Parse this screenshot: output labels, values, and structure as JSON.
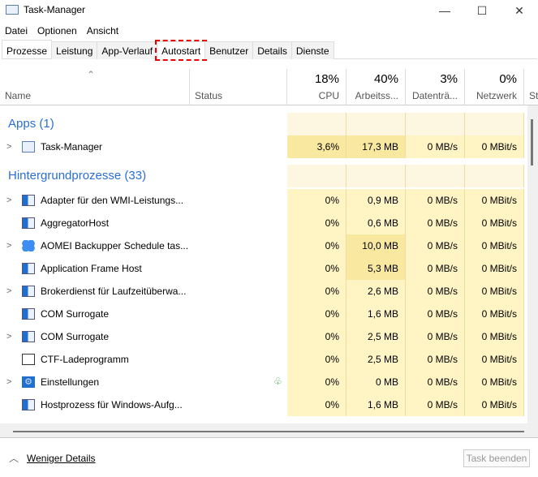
{
  "window": {
    "title": "Task-Manager",
    "minimize": "—",
    "maximize": "☐",
    "close": "✕"
  },
  "menu": [
    "Datei",
    "Optionen",
    "Ansicht"
  ],
  "tabs": [
    "Prozesse",
    "Leistung",
    "App-Verlauf",
    "Autostart",
    "Benutzer",
    "Details",
    "Dienste"
  ],
  "columns": {
    "name": "Name",
    "status": "Status",
    "cpu_pct": "18%",
    "cpu": "CPU",
    "mem_pct": "40%",
    "mem": "Arbeitss...",
    "disk_pct": "3%",
    "disk": "Datenträ...",
    "net_pct": "0%",
    "net": "Netzwerk",
    "extra": "St"
  },
  "groups": {
    "apps": "Apps (1)",
    "background": "Hintergrundprozesse (33)"
  },
  "apps": [
    {
      "name": "Task-Manager",
      "cpu": "3,6%",
      "mem": "17,3 MB",
      "disk": "0 MB/s",
      "net": "0 MBit/s"
    }
  ],
  "processes": [
    {
      "name": "Adapter für den WMI-Leistungs...",
      "cpu": "0%",
      "mem": "0,9 MB",
      "disk": "0 MB/s",
      "net": "0 MBit/s",
      "expand": true,
      "icon": "window-icon"
    },
    {
      "name": "AggregatorHost",
      "cpu": "0%",
      "mem": "0,6 MB",
      "disk": "0 MB/s",
      "net": "0 MBit/s",
      "expand": false,
      "icon": "window-icon"
    },
    {
      "name": "AOMEI Backupper Schedule tas...",
      "cpu": "0%",
      "mem": "10,0 MB",
      "disk": "0 MB/s",
      "net": "0 MBit/s",
      "expand": true,
      "icon": "aomei-icon"
    },
    {
      "name": "Application Frame Host",
      "cpu": "0%",
      "mem": "5,3 MB",
      "disk": "0 MB/s",
      "net": "0 MBit/s",
      "expand": false,
      "icon": "window-icon"
    },
    {
      "name": "Brokerdienst für Laufzeitüberwa...",
      "cpu": "0%",
      "mem": "2,6 MB",
      "disk": "0 MB/s",
      "net": "0 MBit/s",
      "expand": true,
      "icon": "window-icon"
    },
    {
      "name": "COM Surrogate",
      "cpu": "0%",
      "mem": "1,6 MB",
      "disk": "0 MB/s",
      "net": "0 MBit/s",
      "expand": false,
      "icon": "window-icon"
    },
    {
      "name": "COM Surrogate",
      "cpu": "0%",
      "mem": "2,5 MB",
      "disk": "0 MB/s",
      "net": "0 MBit/s",
      "expand": true,
      "icon": "window-icon"
    },
    {
      "name": "CTF-Ladeprogramm",
      "cpu": "0%",
      "mem": "2,5 MB",
      "disk": "0 MB/s",
      "net": "0 MBit/s",
      "expand": false,
      "icon": "notepad-pen-icon"
    },
    {
      "name": "Einstellungen",
      "cpu": "0%",
      "mem": "0 MB",
      "disk": "0 MB/s",
      "net": "0 MBit/s",
      "expand": true,
      "icon": "settings-gear-icon",
      "status_icon": "leaf-icon"
    },
    {
      "name": "Hostprozess für Windows-Aufg...",
      "cpu": "0%",
      "mem": "1,6 MB",
      "disk": "0 MB/s",
      "net": "0 MBit/s",
      "expand": false,
      "icon": "window-icon"
    }
  ],
  "footer": {
    "less_details": "Weniger Details",
    "end_task": "Task beenden"
  },
  "colors": {
    "accent": "#2a6fd6",
    "highlight": "#e00000",
    "heat": "#fff4c4"
  }
}
